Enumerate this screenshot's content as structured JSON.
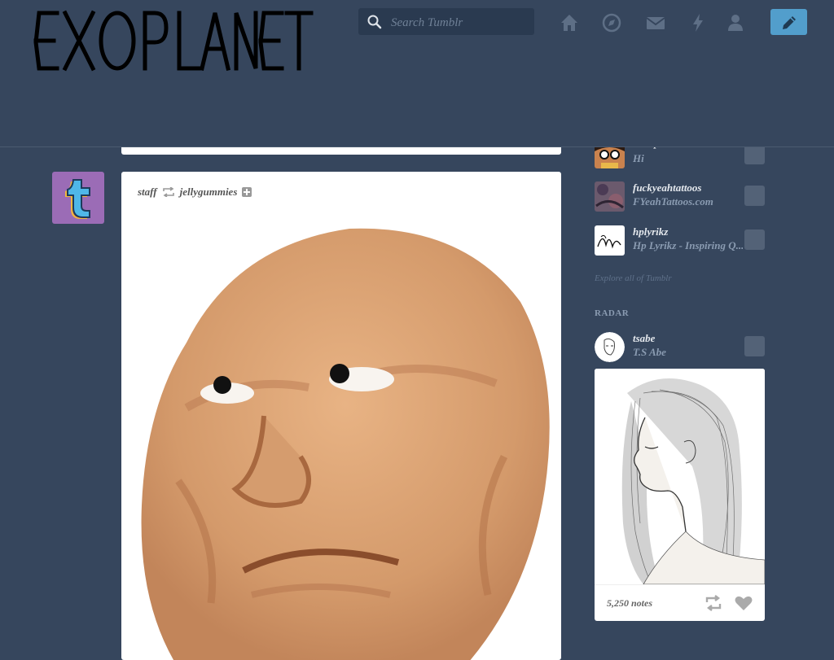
{
  "blog": {
    "title": "EXO PLANET"
  },
  "search": {
    "placeholder": "Search Tumblr",
    "value": ""
  },
  "nav": {
    "icons": [
      "home-icon",
      "explore-icon",
      "inbox-icon",
      "activity-icon",
      "account-icon"
    ],
    "compose_icon": "pencil-icon"
  },
  "post": {
    "author": "staff",
    "reblogged_from": "jellygummies"
  },
  "sidebar": {
    "recommended": [
      {
        "username": "love-personal",
        "title": "Hi"
      },
      {
        "username": "fuckyeahtattoos",
        "title": "FYeahTattoos.com"
      },
      {
        "username": "hplyrikz",
        "title": "Hp Lyrikz - Inspiring Q..."
      }
    ],
    "explore_link": "Explore all of Tumblr",
    "radar": {
      "label": "RADAR",
      "username": "tsabe",
      "title": "T.S Abe",
      "notes": "5,250 notes"
    }
  },
  "colors": {
    "background": "#36465d",
    "compose": "#529ecc",
    "search_bg": "#2a3a50"
  }
}
